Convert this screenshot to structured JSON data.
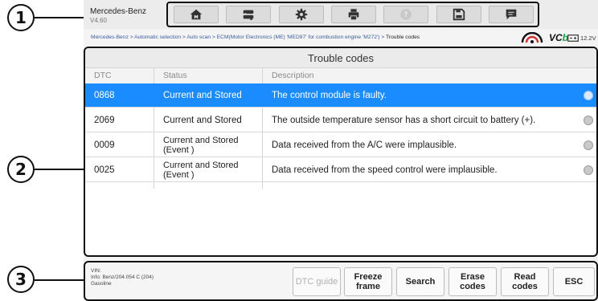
{
  "callouts": [
    "1",
    "2",
    "3"
  ],
  "header": {
    "brand": "Mercedes-Benz",
    "version": "V4.60",
    "toolbar_icons": [
      "home-icon",
      "vehicle-swap-icon",
      "settings-gear-icon",
      "printer-icon",
      "help-icon",
      "save-icon",
      "message-icon"
    ]
  },
  "breadcrumb": {
    "path": "Mercedes-Benz > Automatic selection > Auto scan > ECM(Motor Electronics (ME) 'MED97' for combustion engine 'M272') > ",
    "current": "Trouble codes",
    "vci_label_1": "VC",
    "vci_label_2": "b",
    "voltage": "12.2V"
  },
  "table": {
    "title": "Trouble codes",
    "columns": [
      "DTC",
      "Status",
      "Description"
    ],
    "rows": [
      {
        "dtc": "0868",
        "status": "Current and Stored",
        "description": "The control module is faulty.",
        "selected": true
      },
      {
        "dtc": "2069",
        "status": "Current and Stored",
        "description": "The outside temperature sensor has a short circuit to battery (+).",
        "selected": false
      },
      {
        "dtc": "0009",
        "status": "Current and Stored (Event )",
        "description": "Data received from the A/C were implausible.",
        "selected": false
      },
      {
        "dtc": "0025",
        "status": "Current and Stored (Event )",
        "description": "Data received from the speed control were implausible.",
        "selected": false
      }
    ]
  },
  "footer": {
    "vin": "VIN:",
    "info": "Info: Benz/204.054 C (204)",
    "fuel": "Gasoline",
    "buttons": {
      "dtc_guide": "DTC guide",
      "freeze_frame_1": "Freeze",
      "freeze_frame_2": "frame",
      "search": "Search",
      "erase_1": "Erase",
      "erase_2": "codes",
      "read_1": "Read",
      "read_2": "codes",
      "esc": "ESC"
    }
  },
  "colors": {
    "selected_row": "#1a8cff",
    "vcb_accent": "#1c9c4b",
    "link_blue": "#3b5b9e"
  }
}
